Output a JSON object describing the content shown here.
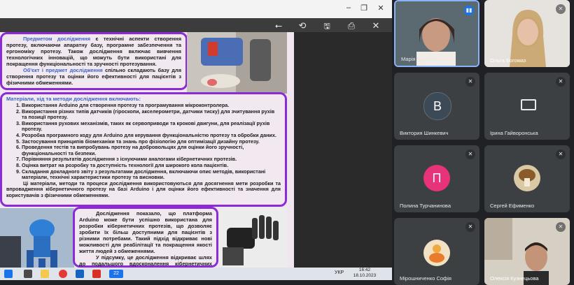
{
  "window": {
    "minimize": "–",
    "restore": "❐",
    "close": "✕"
  },
  "toolbar": {
    "back": "⭠",
    "rotate": "⟲",
    "save": "🖫",
    "print": "⎙",
    "close": "✕"
  },
  "slide": {
    "box1": {
      "p1_term": "Предметом дослідження",
      "p1_text": " є технічні аспекти створення протезу, включаючи апаратну базу, програмне забезпечення та ергономіку протезу. Також дослідження включає вивчення технологічних інновацій, що можуть бути використані для покращення функціональності та зручності протезування.",
      "p2_term": "Об'єкт і предмет дослідження",
      "p2_text": " спільно складають базу для створення протезу та оцінки його ефективності для пацієнтів з фізичними обмеженнями."
    },
    "box2": {
      "heading": "Матеріали, хід та методи дослідження включають:",
      "items": [
        "Використання Arduino для створення протезу та програмування мікроконтролера.",
        "Використання різних типів датчиків (гіроскопи, акселерометри, датчики тиску) для зчитування рухів та позиції протезу.",
        "Використання рухових механізмів, таких як сервоприводи та крокові двигуни, для реалізації рухів протезу.",
        "Розробка програмного коду для Arduino для керування функціональністю протезу та обробки даних.",
        "Застосування принципів біомеханіки та знань про фізіологію для оптимізації дизайну протезу.",
        "Проведення тестів та випробувань протезу на добровольцях для оцінки його зручності, функціональності та безпеки.",
        "Порівняння результатів дослідження з існуючими аналогами кібернетичних протезів.",
        "Оцінка витрат на розробку та доступність технології для широкого кола пацієнтів.",
        "Складання докладного звіту з результатами дослідження, включаючи опис методів, використані матеріали, технічні характеристики протезу та висновки."
      ],
      "summary": "Ці матеріали, методи та процеси дослідження використовуються для досягнення мети розробки та впровадження кібернетичного протезу на базі Arduino і для оцінки його ефективності та значення для користувачів з фізичними обмеженнями."
    },
    "box3": {
      "p1": "Дослідження показало, що платформа Arduino може бути успішно використана для розробки кібернетичних протезів, що дозволяє зробити їх більш доступними для пацієнтів з різними потребами. Такий підхід відкриває нові можливості для реабілітації та покращення якості життя людей з обмеженнями.",
      "p2": "У підсумку, це дослідження відкриває шлях до подальшого вдосконалення кібернетичних протезів"
    }
  },
  "taskbar": {
    "lang": "УКР",
    "time": "16:42",
    "date": "18.10.2023",
    "badge": "22"
  },
  "participants": [
    {
      "name": "Марія Крьомна",
      "type": "video",
      "mic": "active"
    },
    {
      "name": "Ольга Богомаз",
      "type": "video",
      "mic": "muted"
    },
    {
      "name": "Виктория Шинкевич",
      "type": "avatar",
      "initial": "В",
      "color": "#3c4a57",
      "mic": "muted"
    },
    {
      "name": "Ірина Гайворонська",
      "type": "camera-off",
      "mic": "muted"
    },
    {
      "name": "Полина Турчанинова",
      "type": "avatar",
      "initial": "П",
      "color": "#e8337a",
      "mic": "muted"
    },
    {
      "name": "Сергей Ефименко",
      "type": "picture",
      "mic": "muted"
    },
    {
      "name": "Мірошниченко Софія",
      "type": "picture2",
      "mic": "muted"
    },
    {
      "name": "Олексія Кузнецьова",
      "type": "video2",
      "mic": "muted"
    }
  ]
}
